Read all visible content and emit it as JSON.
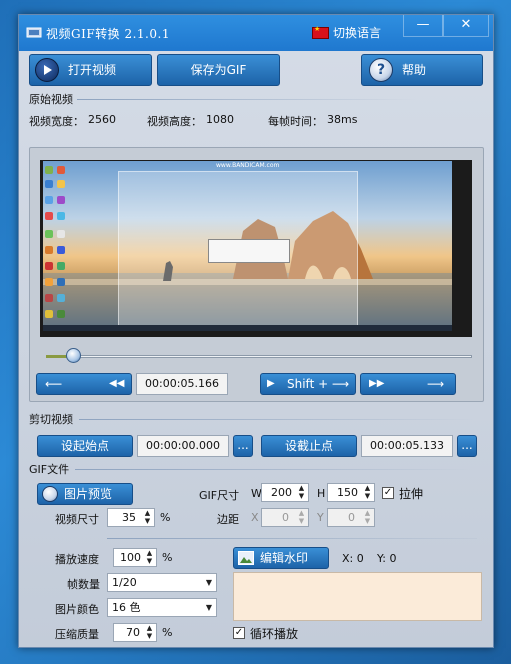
{
  "titlebar": {
    "title": "视频GIF转换 2.1.0.1",
    "language_label": "切换语言",
    "minimize": "—",
    "close": "✕"
  },
  "toolbar": {
    "open_video": "打开视频",
    "save_gif": "保存为GIF",
    "help": "帮助"
  },
  "original_video": {
    "section": "原始视频",
    "width_label": "视频宽度：",
    "width_value": "2560",
    "height_label": "视频高度：",
    "height_value": "1080",
    "frame_time_label": "每帧时间：",
    "frame_time_value": "38ms",
    "preview_url_text": "www.BANDICAM.com",
    "progress_fraction": 0.065,
    "current_time": "00:00:05.166",
    "shift_label": "Shift + ⟶"
  },
  "cut_video": {
    "section": "剪切视频",
    "set_start": "设起始点",
    "start_time": "00:00:00.000",
    "set_end": "设截止点",
    "end_time": "00:00:05.133",
    "dots": "..."
  },
  "gif_file": {
    "section": "GIF文件",
    "preview_button": "图片预览",
    "video_size_label": "视频尺寸",
    "video_size_value": "35",
    "percent": "%",
    "gif_size_label": "GIF尺寸",
    "w_label": "W",
    "w_value": "200",
    "h_label": "H",
    "h_value": "150",
    "stretch_label": "拉伸",
    "stretch_checked": true,
    "margin_label": "边距",
    "x_label": "X",
    "x_value": "0",
    "y_label": "Y",
    "y_value": "0",
    "speed_label": "播放速度",
    "speed_value": "100",
    "frames_label": "帧数量",
    "frames_value": "1/20",
    "colors_label": "图片颜色",
    "colors_value": "16 色",
    "quality_label": "压缩质量",
    "quality_value": "70",
    "watermark_button": "编辑水印",
    "wm_x": "X: 0",
    "wm_y": "Y: 0",
    "loop_label": "循环播放",
    "loop_checked": true
  },
  "colors": {
    "titlebar": "#1f78cf",
    "button": "#1d63a8",
    "watermark_bg": "#fbebd9"
  }
}
